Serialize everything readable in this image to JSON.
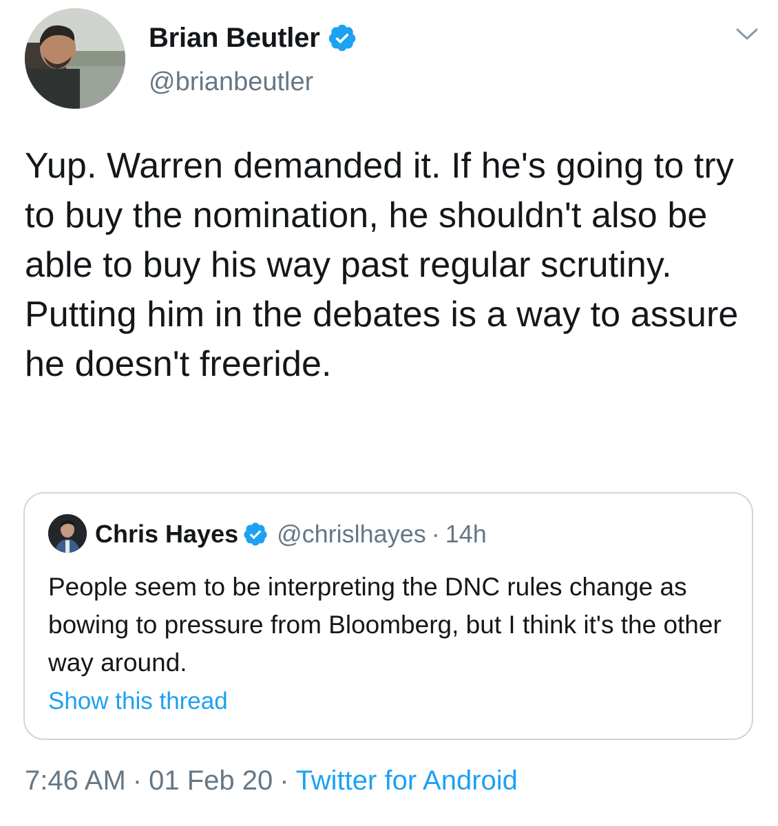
{
  "author": {
    "name": "Brian Beutler",
    "handle": "@brianbeutler",
    "verified": true
  },
  "tweet": {
    "text": "Yup. Warren demanded it. If he's going to try to buy the nomination, he shouldn't also be able to buy his way past regular scrutiny. Putting him in the debates is a way to assure he doesn't freeride."
  },
  "quoted_tweet": {
    "name": "Chris Hayes",
    "handle": "@chrislhayes",
    "separator": "·",
    "time": "14h",
    "verified": true,
    "text": "People seem to be interpreting the DNC rules change as bowing to pressure from Bloomberg, but I think it's the other way around.",
    "show_thread_label": "Show this thread"
  },
  "footer": {
    "time": "7:46 AM",
    "separator": "·",
    "date": "01 Feb 20",
    "source": "Twitter for Android"
  },
  "icons": {
    "verified": "verified-badge-icon",
    "menu": "chevron-down-icon"
  },
  "colors": {
    "accent": "#1da1f2",
    "text": "#14171a",
    "muted": "#657786",
    "border": "#ccd6dd"
  }
}
